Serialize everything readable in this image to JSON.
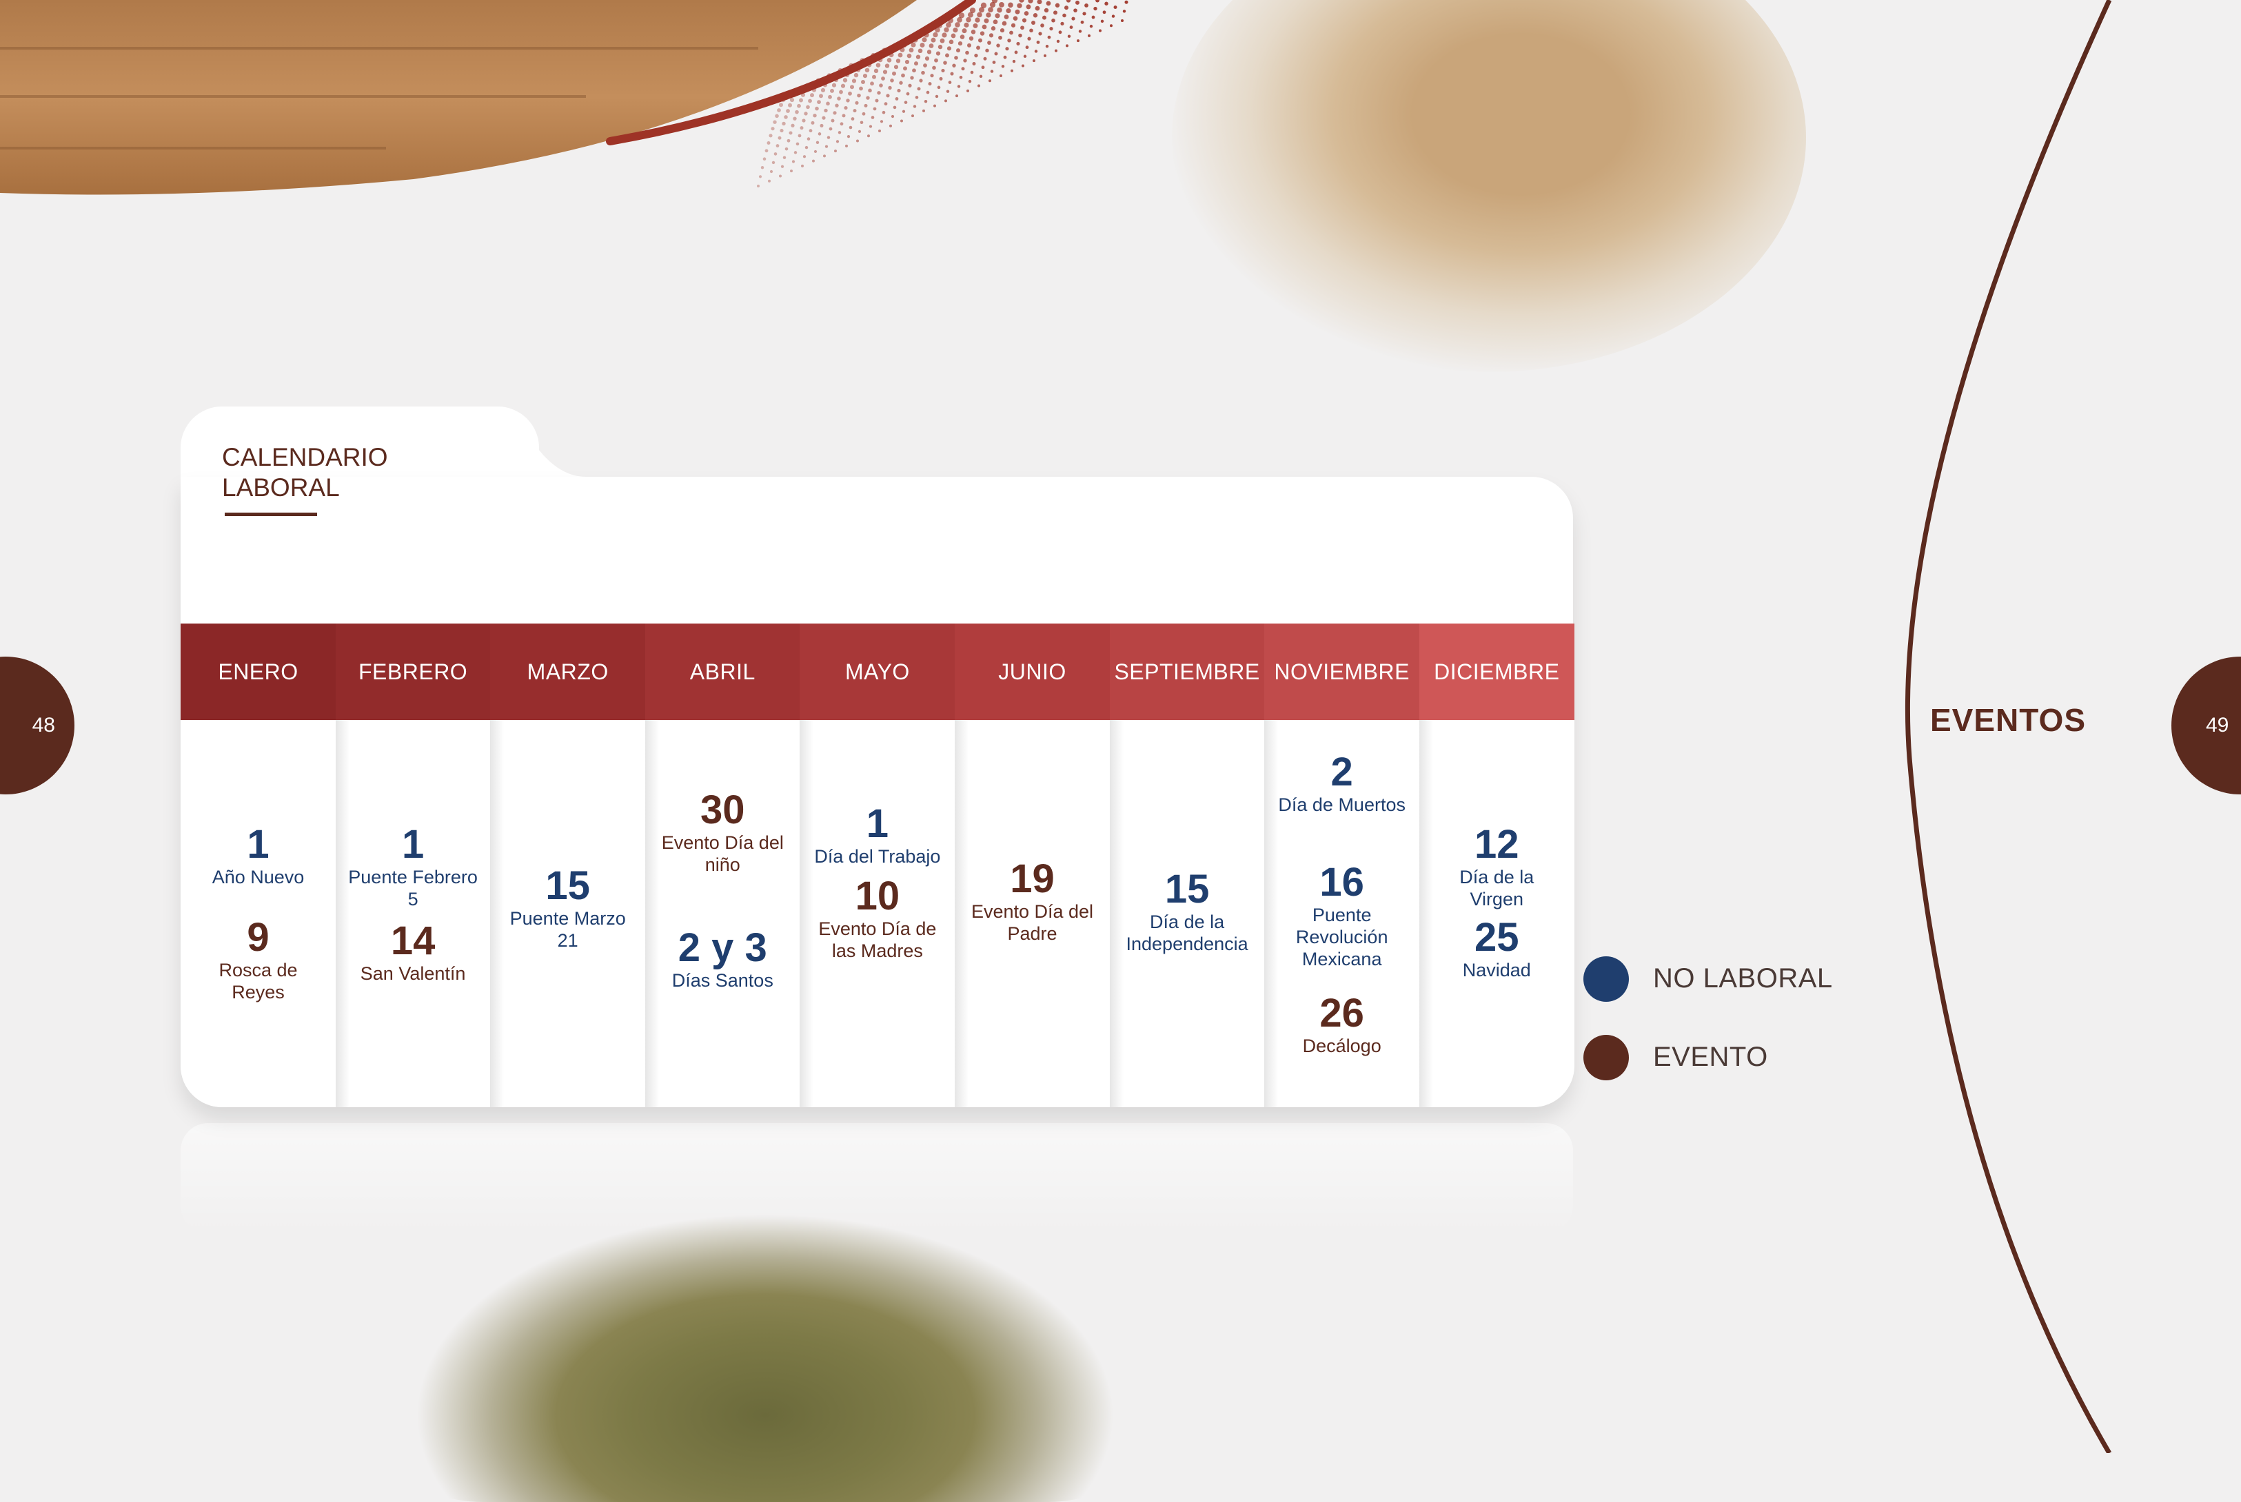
{
  "colors": {
    "background": "#f1f0f0",
    "brown": "#5b2a1e",
    "navy": "#1f3e6e",
    "header_red_dark": "#8e2a2a",
    "header_red_light": "#d05a5a"
  },
  "pages": {
    "left": "48",
    "right": "49"
  },
  "section_title": "EVENTOS",
  "card": {
    "title_line1": "CALENDARIO",
    "title_line2": "LABORAL"
  },
  "months": [
    {
      "name": "ENERO",
      "entries": [
        {
          "day": "1",
          "label": "Año Nuevo",
          "type": "no_laboral"
        },
        {
          "day": "9",
          "label": "Rosca de Reyes",
          "type": "evento"
        }
      ]
    },
    {
      "name": "FEBRERO",
      "entries": [
        {
          "day": "1",
          "label": "Puente Febrero 5",
          "type": "no_laboral"
        },
        {
          "day": "14",
          "label": "San Valentín",
          "type": "evento"
        }
      ]
    },
    {
      "name": "MARZO",
      "entries": [
        {
          "day": "15",
          "label": "Puente Marzo 21",
          "type": "no_laboral"
        }
      ]
    },
    {
      "name": "ABRIL",
      "entries": [
        {
          "day": "30",
          "label": "Evento Día del niño",
          "type": "evento"
        },
        {
          "day": "2 y 3",
          "label": "Días Santos",
          "type": "no_laboral"
        }
      ]
    },
    {
      "name": "MAYO",
      "entries": [
        {
          "day": "1",
          "label": "Día del Trabajo",
          "type": "no_laboral"
        },
        {
          "day": "10",
          "label": "Evento Día de las Madres",
          "type": "evento"
        }
      ]
    },
    {
      "name": "JUNIO",
      "entries": [
        {
          "day": "19",
          "label": "Evento Día del Padre",
          "type": "evento"
        }
      ]
    },
    {
      "name": "SEPTIEMBRE",
      "entries": [
        {
          "day": "15",
          "label": "Día de la Independencia",
          "type": "no_laboral"
        }
      ]
    },
    {
      "name": "NOVIEMBRE",
      "entries": [
        {
          "day": "2",
          "label": "Día de Muertos",
          "type": "no_laboral"
        },
        {
          "day": "16",
          "label": "Puente Revolución Mexicana",
          "type": "no_laboral"
        },
        {
          "day": "26",
          "label": "Decálogo",
          "type": "evento"
        }
      ]
    },
    {
      "name": "DICIEMBRE",
      "entries": [
        {
          "day": "12",
          "label": "Día de la Virgen",
          "type": "no_laboral"
        },
        {
          "day": "25",
          "label": "Navidad",
          "type": "no_laboral"
        }
      ]
    }
  ],
  "legend": [
    {
      "label": "NO LABORAL",
      "color": "#1f3e6e"
    },
    {
      "label": "EVENTO",
      "color": "#5b2a1e"
    }
  ]
}
